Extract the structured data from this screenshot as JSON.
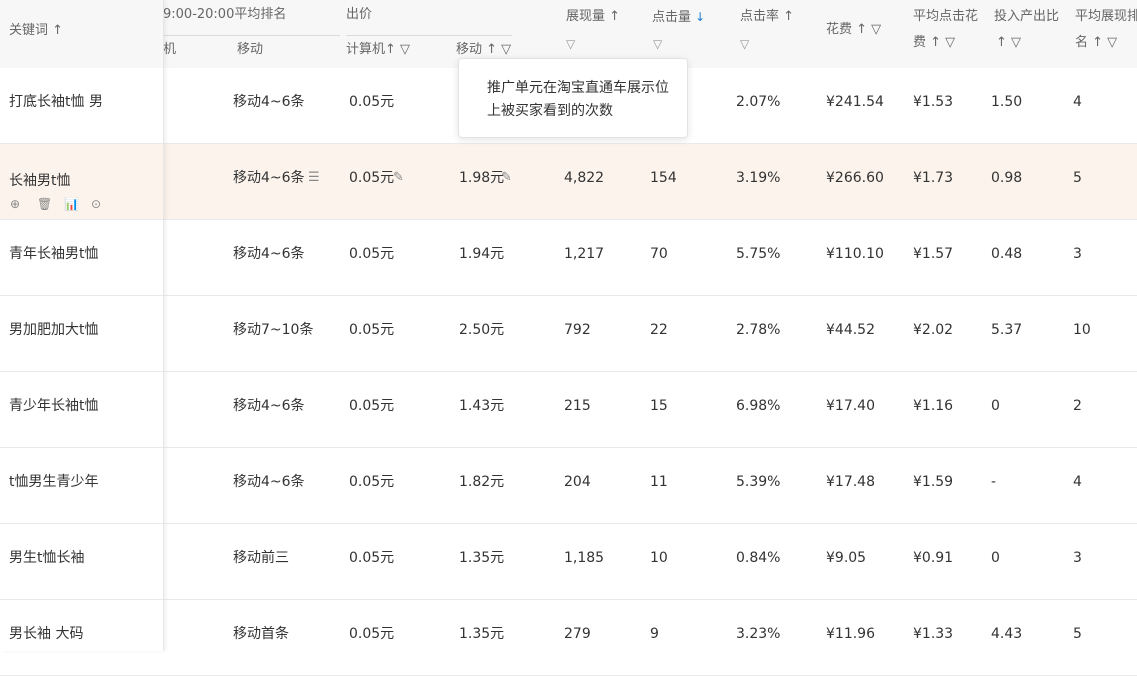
{
  "header": {
    "keyword": "关键词 ↑",
    "time_rank": "9:00-20:00平均排名",
    "pc_sub": "机",
    "mobile_sub": "移动",
    "bid": "出价",
    "bid_pc": "计算机↑ ▽",
    "bid_mobile": "移动 ↑ ▽",
    "impressions": "展现量 ↑",
    "clicks": "点击量",
    "clicks_sort": "↓",
    "ctr": "点击率 ↑",
    "cost": "花费 ↑ ▽",
    "avg_cpc_1": "平均点击花",
    "avg_cpc_2": "费 ↑ ▽",
    "roi_1": "投入产出比",
    "roi_2": "↑ ▽",
    "avg_rank_1": "平均展现排",
    "avg_rank_2": "名 ↑ ▽",
    "filter": "▽"
  },
  "tooltip": {
    "line1": "推广单元在淘宝直通车展示位",
    "line2": "上被买家看到的次数"
  },
  "row_icons": {
    "locate": "⊕",
    "delete": "🗑",
    "chart": "📊",
    "more": "⊙"
  },
  "rows": [
    {
      "keyword": "打底长袖t恤 男",
      "mobile_rank": "移动4~6条",
      "bid_pc": "0.05元",
      "bid_mobile": "",
      "impressions": "",
      "clicks": "",
      "ctr": "2.07%",
      "cost": "¥241.54",
      "cpc": "¥1.53",
      "roi": "1.50",
      "rank": "4"
    },
    {
      "keyword": "长袖男t恤",
      "mobile_rank": "移动4~6条",
      "bid_pc": "0.05元",
      "bid_mobile": "1.98元",
      "impressions": "4,822",
      "clicks": "154",
      "ctr": "3.19%",
      "cost": "¥266.60",
      "cpc": "¥1.73",
      "roi": "0.98",
      "rank": "5"
    },
    {
      "keyword": "青年长袖男t恤",
      "mobile_rank": "移动4~6条",
      "bid_pc": "0.05元",
      "bid_mobile": "1.94元",
      "impressions": "1,217",
      "clicks": "70",
      "ctr": "5.75%",
      "cost": "¥110.10",
      "cpc": "¥1.57",
      "roi": "0.48",
      "rank": "3"
    },
    {
      "keyword": "男加肥加大t恤",
      "mobile_rank": "移动7~10条",
      "bid_pc": "0.05元",
      "bid_mobile": "2.50元",
      "impressions": "792",
      "clicks": "22",
      "ctr": "2.78%",
      "cost": "¥44.52",
      "cpc": "¥2.02",
      "roi": "5.37",
      "rank": "10"
    },
    {
      "keyword": "青少年长袖t恤",
      "mobile_rank": "移动4~6条",
      "bid_pc": "0.05元",
      "bid_mobile": "1.43元",
      "impressions": "215",
      "clicks": "15",
      "ctr": "6.98%",
      "cost": "¥17.40",
      "cpc": "¥1.16",
      "roi": "0",
      "rank": "2"
    },
    {
      "keyword": "t恤男生青少年",
      "mobile_rank": "移动4~6条",
      "bid_pc": "0.05元",
      "bid_mobile": "1.82元",
      "impressions": "204",
      "clicks": "11",
      "ctr": "5.39%",
      "cost": "¥17.48",
      "cpc": "¥1.59",
      "roi": "-",
      "rank": "4"
    },
    {
      "keyword": "男生t恤长袖",
      "mobile_rank": "移动前三",
      "bid_pc": "0.05元",
      "bid_mobile": "1.35元",
      "impressions": "1,185",
      "clicks": "10",
      "ctr": "0.84%",
      "cost": "¥9.05",
      "cpc": "¥0.91",
      "roi": "0",
      "rank": "3"
    },
    {
      "keyword": "男长袖 大码",
      "mobile_rank": "移动首条",
      "bid_pc": "0.05元",
      "bid_mobile": "1.35元",
      "impressions": "279",
      "clicks": "9",
      "ctr": "3.23%",
      "cost": "¥11.96",
      "cpc": "¥1.33",
      "roi": "4.43",
      "rank": "5"
    }
  ]
}
